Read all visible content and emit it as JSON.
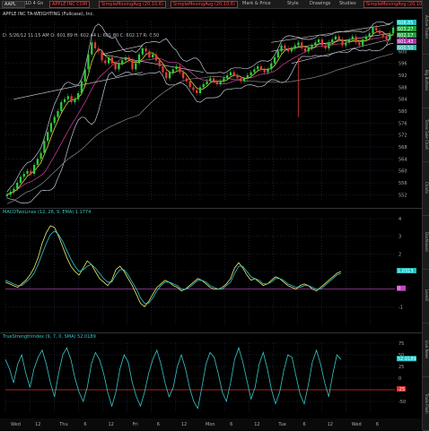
{
  "toolbar": {
    "symbol": "AAPL",
    "interval": "1D 4 Gn",
    "company": "APPLE INC COM",
    "quote_line": "APPLE INC TA-WEIGHTING (Fullcase), Inc.",
    "red_box_1": "SimpleMovingAvg (20,10,6)",
    "red_box_2": "SimpleMovingAvg (20,10,6)",
    "red_box_3": "SimpleMovingAvg (20,10,6)",
    "ohlc": "D: 5/26/12 11:15 AM  O: 601.89  H: 602.44  L: 601.80  C: 602.17  R: 0.50",
    "buttons": [
      "Mark & Price",
      "Style",
      "Drawings",
      "Studies"
    ]
  },
  "right_tabs": [
    "Active Trader",
    "Big Buttons",
    "Times Sale Chart",
    "Charts",
    "Dashboard",
    "Level2",
    "Live News",
    "Trade Flash"
  ],
  "colors": {
    "background": "#000000",
    "grid": "#2b3a55",
    "candle_up": "#2ecc40",
    "candle_down": "#e23b3b",
    "bollinger": "#bfc6d6",
    "sma_fast": "#e0d03a",
    "sma_mid": "#c0398c",
    "sma_slow": "#8a8a8a",
    "trendline": "#d8d8d8",
    "macd": "#f0f070",
    "macd_avg": "#37c7c7",
    "zero_line": "#c048c0",
    "tsi": "#37c7c7",
    "tsi_level": "#d83030",
    "price_tag_green": "#1f9f3a",
    "price_tag_cyan": "#1fbfbf",
    "price_tag_magenta": "#b52fb5"
  },
  "chart_data": [
    {
      "type": "candlestick",
      "title": "",
      "y_ticks": [
        "608",
        "604",
        "600",
        "596",
        "592",
        "588",
        "584",
        "580",
        "576",
        "572",
        "568",
        "564",
        "560",
        "556",
        "552"
      ],
      "ylim": [
        550,
        610
      ],
      "price_tags": [
        "608.85",
        "603.27",
        "602.17",
        "601.43",
        "600.50"
      ],
      "close": [
        552,
        553,
        554,
        556,
        558,
        559,
        560,
        559,
        562,
        564,
        566,
        570,
        573,
        576,
        578,
        580,
        583,
        584,
        585,
        583,
        584,
        586,
        590,
        594,
        599,
        603,
        601,
        600,
        597,
        596,
        598,
        596,
        594,
        596,
        597,
        598,
        597,
        594,
        596,
        599,
        601,
        600,
        598,
        599,
        597,
        595,
        593,
        591,
        593,
        594,
        595,
        593,
        591,
        590,
        588,
        587,
        586,
        588,
        589,
        590,
        591,
        590,
        589,
        590,
        591,
        592,
        593,
        592,
        591,
        590,
        591,
        592,
        593,
        594,
        595,
        594,
        593,
        594,
        596,
        598,
        600,
        602,
        601,
        600,
        601,
        602,
        603,
        601,
        600,
        601,
        602,
        603,
        604,
        602,
        601,
        603,
        604,
        605,
        604,
        602,
        603,
        604,
        605,
        603,
        602,
        604,
        605,
        606,
        608,
        607,
        606,
        605,
        604,
        606,
        608
      ],
      "x_ticks": [
        "Wed",
        "12",
        "Thu",
        "6",
        "12",
        "Fri",
        "6",
        "12",
        "Mon",
        "6",
        "12",
        "Tue",
        "6",
        "12",
        "Wed",
        "6"
      ]
    },
    {
      "type": "line",
      "title": "",
      "legend": "MACDTwoLines (12, 26, 9, EMA)  1.1774",
      "ylim": [
        -2,
        4
      ],
      "y_ticks": [
        "4",
        "3",
        "2",
        "1",
        "0",
        "-1"
      ],
      "price_tag": "1.0313",
      "zero_tag": "0",
      "series": [
        {
          "name": "Value",
          "values": [
            0.4,
            0.3,
            0.2,
            0.1,
            0.3,
            0.5,
            0.8,
            1.2,
            1.8,
            2.6,
            3.2,
            3.6,
            3.5,
            3.0,
            2.4,
            1.8,
            1.3,
            1.0,
            0.8,
            1.2,
            1.6,
            1.4,
            1.0,
            0.6,
            0.4,
            0.2,
            0.5,
            1.1,
            1.3,
            1.0,
            0.6,
            0.2,
            -0.3,
            -0.8,
            -1.0,
            -0.7,
            -0.3,
            0.1,
            0.3,
            0.5,
            0.4,
            0.2,
            0.1,
            -0.1,
            0.0,
            0.2,
            0.4,
            0.6,
            0.5,
            0.3,
            0.1,
            0.0,
            0.0,
            0.1,
            0.3,
            0.6,
            1.2,
            1.5,
            1.2,
            0.8,
            0.5,
            0.6,
            0.4,
            0.2,
            0.3,
            0.5,
            0.7,
            0.6,
            0.4,
            0.2,
            0.1,
            0.0,
            0.2,
            0.3,
            0.2,
            0.0,
            -0.1,
            0.1,
            0.3,
            0.5,
            0.7,
            0.9,
            1.0
          ]
        },
        {
          "name": "Avg",
          "values": [
            0.5,
            0.4,
            0.3,
            0.2,
            0.2,
            0.4,
            0.6,
            0.9,
            1.4,
            2.0,
            2.6,
            3.1,
            3.3,
            3.1,
            2.7,
            2.2,
            1.7,
            1.3,
            1.0,
            1.1,
            1.3,
            1.4,
            1.2,
            0.9,
            0.6,
            0.4,
            0.4,
            0.8,
            1.1,
            1.1,
            0.8,
            0.4,
            0.0,
            -0.5,
            -0.8,
            -0.8,
            -0.5,
            -0.1,
            0.2,
            0.4,
            0.4,
            0.3,
            0.2,
            0.0,
            0.0,
            0.1,
            0.3,
            0.5,
            0.5,
            0.4,
            0.2,
            0.1,
            0.0,
            0.0,
            0.2,
            0.4,
            0.9,
            1.3,
            1.3,
            1.0,
            0.7,
            0.6,
            0.5,
            0.3,
            0.3,
            0.4,
            0.6,
            0.6,
            0.5,
            0.3,
            0.2,
            0.1,
            0.1,
            0.2,
            0.2,
            0.1,
            0.0,
            0.0,
            0.2,
            0.4,
            0.6,
            0.8,
            0.9
          ]
        }
      ]
    },
    {
      "type": "line",
      "title": "",
      "legend": "TrueStrengthIndex (9, 7, 0, SMA)  52.0189",
      "ylim": [
        -75,
        75
      ],
      "y_ticks": [
        "75",
        "50",
        "25",
        "0",
        "-25",
        "-50"
      ],
      "price_tag": "52.0189",
      "level_tag": "-25",
      "series": [
        {
          "name": "TSI",
          "values": [
            40,
            20,
            -10,
            30,
            50,
            10,
            -20,
            20,
            45,
            60,
            30,
            -10,
            -40,
            10,
            50,
            65,
            40,
            0,
            -30,
            -50,
            -20,
            30,
            55,
            40,
            10,
            -30,
            -60,
            -30,
            20,
            50,
            35,
            -10,
            -40,
            -60,
            -30,
            10,
            40,
            60,
            30,
            -10,
            -40,
            -20,
            25,
            50,
            20,
            -20,
            -50,
            -65,
            -20,
            30,
            55,
            45,
            10,
            -30,
            -50,
            -10,
            40,
            65,
            35,
            -5,
            -45,
            -20,
            30,
            55,
            20,
            -25,
            -55,
            -30,
            15,
            50,
            45,
            5,
            -35,
            -55,
            -15,
            35,
            60,
            30,
            -10,
            -40,
            10,
            50,
            40
          ]
        }
      ]
    }
  ]
}
